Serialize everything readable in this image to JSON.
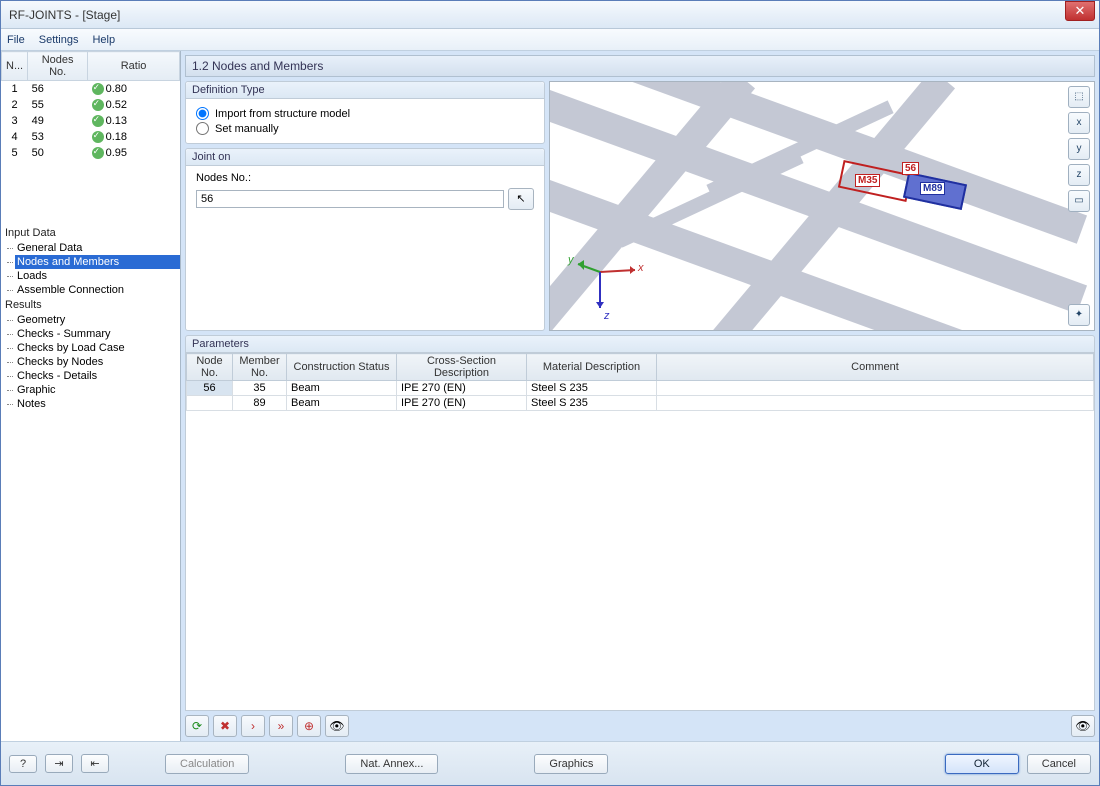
{
  "window": {
    "title": "RF-JOINTS - [Stage]"
  },
  "menu": {
    "file": "File",
    "settings": "Settings",
    "help": "Help"
  },
  "top_table": {
    "headers": {
      "idx": "N...",
      "nodes": "Nodes No.",
      "ratio": "Ratio"
    },
    "rows": [
      {
        "idx": "1",
        "node": "56",
        "ratio": "0.80"
      },
      {
        "idx": "2",
        "node": "55",
        "ratio": "0.52"
      },
      {
        "idx": "3",
        "node": "49",
        "ratio": "0.13"
      },
      {
        "idx": "4",
        "node": "53",
        "ratio": "0.18"
      },
      {
        "idx": "5",
        "node": "50",
        "ratio": "0.95"
      }
    ]
  },
  "tree": {
    "input_data": "Input Data",
    "general_data": "General Data",
    "nodes_members": "Nodes and Members",
    "loads": "Loads",
    "assemble": "Assemble Connection",
    "results": "Results",
    "geometry": "Geometry",
    "checks_summary": "Checks - Summary",
    "checks_loadcase": "Checks by Load Case",
    "checks_nodes": "Checks by Nodes",
    "checks_details": "Checks - Details",
    "graphic": "Graphic",
    "notes": "Notes"
  },
  "content": {
    "header": "1.2 Nodes and Members",
    "def_type": {
      "title": "Definition Type",
      "import": "Import from structure model",
      "manual": "Set manually"
    },
    "joint_on": {
      "title": "Joint on",
      "label": "Nodes No.:",
      "value": "56"
    },
    "viewport_labels": {
      "m35": "M35",
      "n56": "56",
      "m89": "M89",
      "x": "x",
      "y": "y",
      "z": "z"
    }
  },
  "params": {
    "title": "Parameters",
    "headers": {
      "node_no": "Node No.",
      "member_no": "Member No.",
      "constr": "Construction Status",
      "cross": "Cross-Section Description",
      "material": "Material Description",
      "comment": "Comment"
    },
    "rows": [
      {
        "node": "56",
        "member": "35",
        "constr": "Beam",
        "cross": "IPE 270 (EN)",
        "material": "Steel S 235",
        "comment": ""
      },
      {
        "node": "",
        "member": "89",
        "constr": "Beam",
        "cross": "IPE 270 (EN)",
        "material": "Steel S 235",
        "comment": ""
      }
    ]
  },
  "buttons": {
    "calculation": "Calculation",
    "nat_annex": "Nat. Annex...",
    "graphics": "Graphics",
    "ok": "OK",
    "cancel": "Cancel"
  }
}
